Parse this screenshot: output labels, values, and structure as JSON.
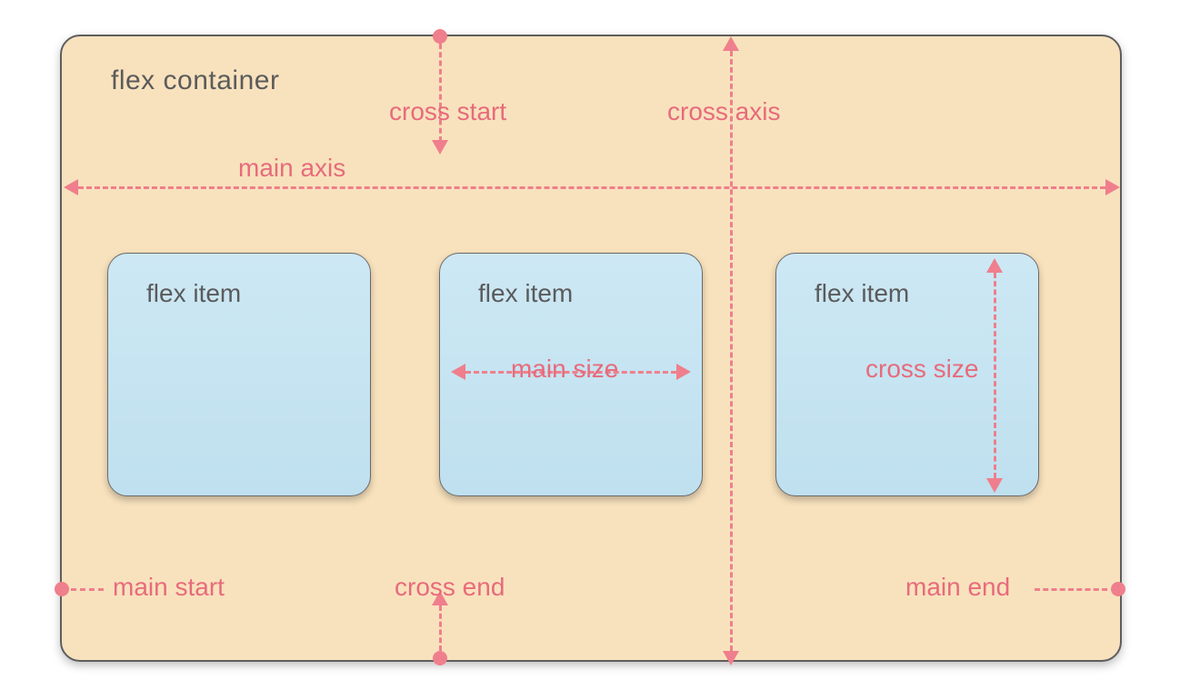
{
  "colors": {
    "container_bg": "#f8e2bd",
    "item_bg": "#bfe0ef",
    "annotation": "#e76b7c",
    "line": "#ef7f8c",
    "text": "#5b5b5b"
  },
  "container": {
    "label": "flex container"
  },
  "items": [
    {
      "label": "flex item"
    },
    {
      "label": "flex item"
    },
    {
      "label": "flex item"
    }
  ],
  "annotations": {
    "cross_start": "cross start",
    "cross_axis": "cross axis",
    "main_axis": "main axis",
    "main_size": "main size",
    "cross_size": "cross size",
    "main_start": "main start",
    "cross_end": "cross end",
    "main_end": "main end"
  }
}
